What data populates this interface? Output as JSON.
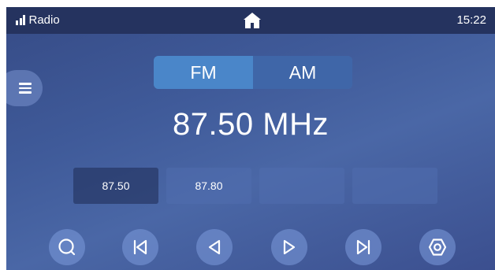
{
  "status_bar": {
    "app_title": "Radio",
    "time": "15:22",
    "signal_icon": "signal-bars-icon",
    "home_icon": "home-icon"
  },
  "menu": {
    "icon": "hamburger-menu-icon"
  },
  "band": {
    "options": [
      "FM",
      "AM"
    ],
    "selected": "FM"
  },
  "tuner": {
    "frequency_display": "87.50 MHz"
  },
  "presets": [
    {
      "label": "87.50",
      "active": true
    },
    {
      "label": "87.80",
      "active": false
    },
    {
      "label": "",
      "active": false
    },
    {
      "label": "",
      "active": false
    }
  ],
  "controls": [
    {
      "name": "search",
      "icon": "search-icon"
    },
    {
      "name": "previous-station",
      "icon": "skip-previous-icon"
    },
    {
      "name": "tune-down",
      "icon": "triangle-left-icon"
    },
    {
      "name": "tune-up",
      "icon": "triangle-right-icon"
    },
    {
      "name": "next-station",
      "icon": "skip-next-icon"
    },
    {
      "name": "settings",
      "icon": "hexagon-settings-icon"
    }
  ],
  "colors": {
    "statusbar_bg": "#25335f",
    "band_active": "#4a86c9",
    "text": "#ffffff"
  }
}
